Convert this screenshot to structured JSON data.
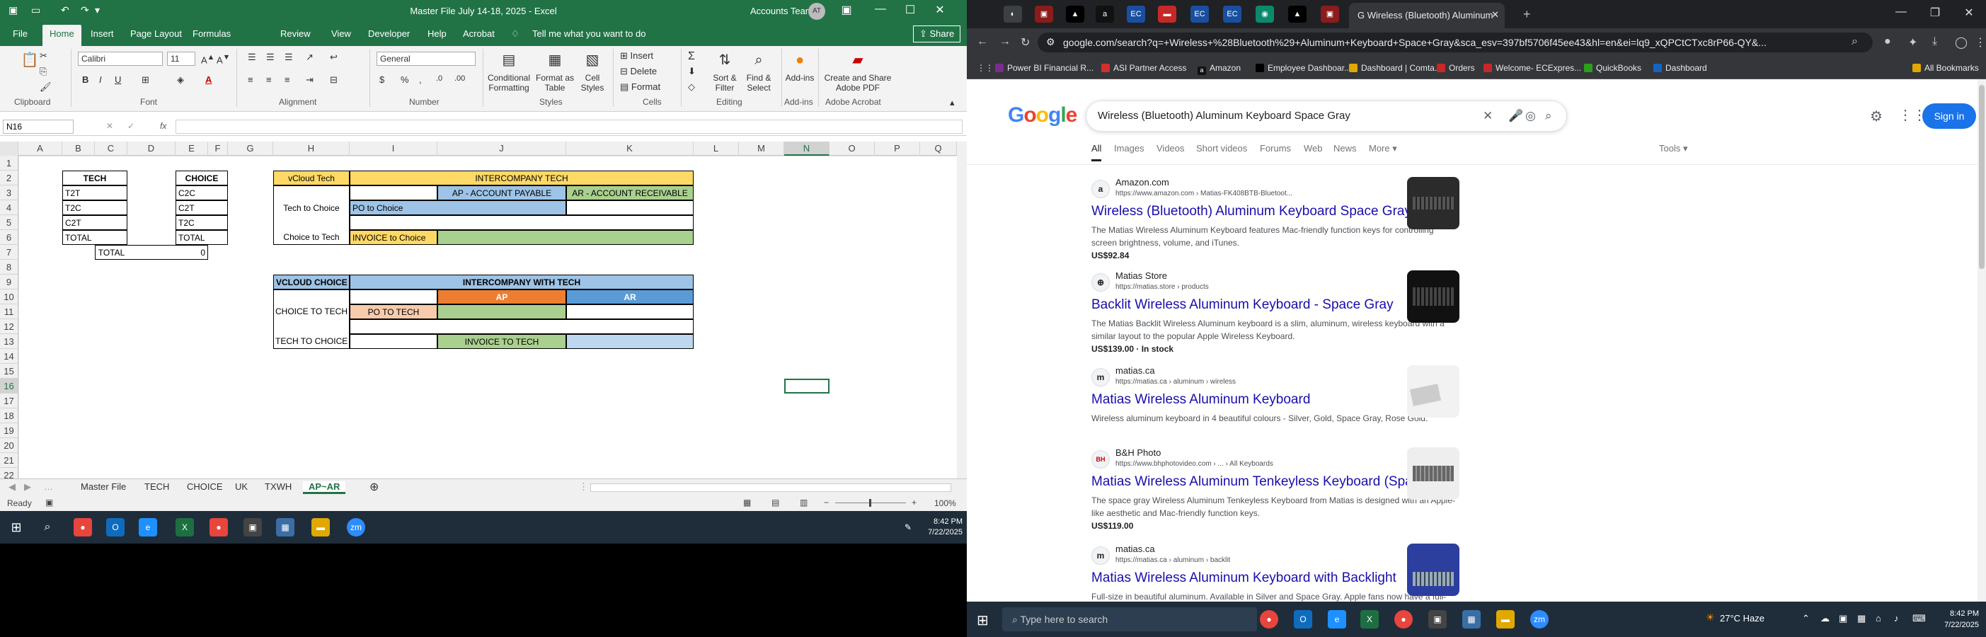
{
  "excel": {
    "title": "Master File July 14-18, 2025  -  Excel",
    "account": "Accounts Team",
    "avatar": "AT",
    "tabs": [
      "File",
      "Home",
      "Insert",
      "Page Layout",
      "Formulas",
      "Review",
      "View",
      "Developer",
      "Help",
      "Acrobat"
    ],
    "tell_me": "Tell me what you want to do",
    "share": "Share",
    "ribbon": {
      "font_name": "Calibri",
      "font_size": "11",
      "number_format": "General",
      "groups": [
        "Clipboard",
        "Font",
        "Alignment",
        "Number",
        "Styles",
        "Cells",
        "Editing",
        "Add-ins",
        "Adobe Acrobat"
      ],
      "buttons": {
        "conditional": "Conditional Formatting",
        "format_table": "Format as Table",
        "cell_styles": "Cell Styles",
        "insert": "Insert",
        "delete": "Delete",
        "format": "Format",
        "sort_filter": "Sort & Filter",
        "find_select": "Find & Select",
        "addins": "Add-ins",
        "create_pdf": "Create and Share Adobe PDF"
      }
    },
    "name_box": "N16",
    "fx": "fx",
    "columns": [
      "A",
      "B",
      "C",
      "D",
      "E",
      "F",
      "G",
      "H",
      "I",
      "J",
      "K",
      "L",
      "M",
      "N",
      "O",
      "P",
      "Q"
    ],
    "rows": [
      "1",
      "2",
      "3",
      "4",
      "5",
      "6",
      "7",
      "8",
      "9",
      "10",
      "11",
      "12",
      "13",
      "14",
      "15",
      "16",
      "17",
      "18",
      "19",
      "20",
      "21",
      "22"
    ],
    "cells": {
      "tech_hdr": "TECH",
      "choice_hdr": "CHOICE",
      "b3": "T2T",
      "b4": "T2C",
      "b5": "C2T",
      "b6": "TOTAL",
      "e3": "C2C",
      "e4": "C2T",
      "e5": "T2C",
      "e6": "TOTAL",
      "total_label": "TOTAL",
      "total_value": "0",
      "vcloud_tech": "vCloud Tech",
      "interco_tech": "INTERCOMPANY TECH",
      "ap_payable": "AP - ACCOUNT PAYABLE",
      "ar_receivable": "AR - ACCOUNT RECEIVABLE",
      "tech_to_choice": "Tech to Choice",
      "po_to_choice": "PO to Choice",
      "choice_to_tech": "Choice to Tech",
      "invoice_to_choice": "INVOICE to Choice",
      "vcloud_choice": "VCLOUD CHOICE",
      "interco_with_tech": "INTERCOMPANY WITH TECH",
      "ap": "AP",
      "ar": "AR",
      "choice_to_tech2": "CHOICE TO TECH",
      "po_to_tech": "PO TO TECH",
      "tech_to_choice2": "TECH TO CHOICE",
      "invoice_to_tech": "INVOICE TO TECH"
    },
    "sheet_tabs": [
      "Master File",
      "TECH",
      "CHOICE",
      "UK",
      "TXWH",
      "AP~AR"
    ],
    "active_sheet": "AP~AR",
    "status": "Ready",
    "zoom": "100%",
    "clock_time": "8:42 PM",
    "clock_date": "7/22/2025"
  },
  "chrome": {
    "active_tab_title": "Wireless (Bluetooth) Aluminum",
    "url": "google.com/search?q=+Wireless+%28Bluetooth%29+Aluminum+Keyboard+Space+Gray&sca_esv=397bf5706f45ee43&hl=en&ei=lq9_xQPCtCTxc8rP66-QY&...",
    "bookmarks": [
      "Power BI Financial R...",
      "ASI Partner Access",
      "Amazon",
      "Employee Dashboar...",
      "Dashboard | Comta...",
      "Orders",
      "Welcome- ECExpres...",
      "QuickBooks",
      "Dashboard"
    ],
    "all_bookmarks": "All Bookmarks",
    "logo": "Google",
    "query": "Wireless (Bluetooth) Aluminum Keyboard Space Gray",
    "sign_in": "Sign in",
    "search_tabs": [
      "All",
      "Images",
      "Videos",
      "Short videos",
      "Forums",
      "Web",
      "News",
      "More"
    ],
    "tools": "Tools",
    "results": [
      {
        "site": "Amazon.com",
        "cite": "https://www.amazon.com › Matias-FK408BTB-Bluetoot...",
        "fav": "a",
        "title": "Wireless (Bluetooth) Aluminum Keyboard Space Gray",
        "snippet": "The Matias Wireless Aluminum Keyboard features Mac-friendly function keys for controlling screen brightness, volume, and iTunes.",
        "price": "US$92.84"
      },
      {
        "site": "Matias Store",
        "cite": "https://matias.store › products",
        "fav": "⊕",
        "title": "Backlit Wireless Aluminum Keyboard - Space Gray",
        "snippet": "The Matias Backlit Wireless Aluminum keyboard is a slim, aluminum, wireless keyboard with a similar layout to the popular Apple Wireless Keyboard.",
        "price": "US$139.00 · In stock"
      },
      {
        "site": "matias.ca",
        "cite": "https://matias.ca › aluminum › wireless",
        "fav": "m",
        "title": "Matias Wireless Aluminum Keyboard",
        "snippet": "Wireless aluminum keyboard in 4 beautiful colours - Silver, Gold, Space Gray, Rose Gold.",
        "price": ""
      },
      {
        "site": "B&H Photo",
        "cite": "https://www.bhphotovideo.com › ... › All Keyboards",
        "fav": "BH",
        "title": "Matias Wireless Aluminum Tenkeyless Keyboard (Space ...",
        "snippet": "The space gray Wireless Aluminum Tenkeyless Keyboard from Matias is designed with an Apple-like aesthetic and Mac-friendly function keys.",
        "price": "US$119.00"
      },
      {
        "site": "matias.ca",
        "cite": "https://matias.ca › aluminum › backlit",
        "fav": "m",
        "title": "Matias Wireless Aluminum Keyboard with Backlight",
        "snippet": "Full-size in beautiful aluminum. Available in Silver and Space Gray. Apple fans now have a full-size wireless keyboard that's backlit, matches the look of ...",
        "price": ""
      }
    ],
    "taskbar_search": "Type here to search",
    "weather": "27°C  Haze",
    "clock_time": "8:42 PM",
    "clock_date": "7/22/2025"
  },
  "colors": {
    "excel_green": "#217346",
    "header_yellow": "#ffd966",
    "header_blue": "#9dc3e6",
    "ar_green": "#a9d08e",
    "po_peach": "#f8cbad",
    "ap_orange": "#ed7d31",
    "ar_blue": "#5b9bd5",
    "google_link": "#1a0dab"
  }
}
